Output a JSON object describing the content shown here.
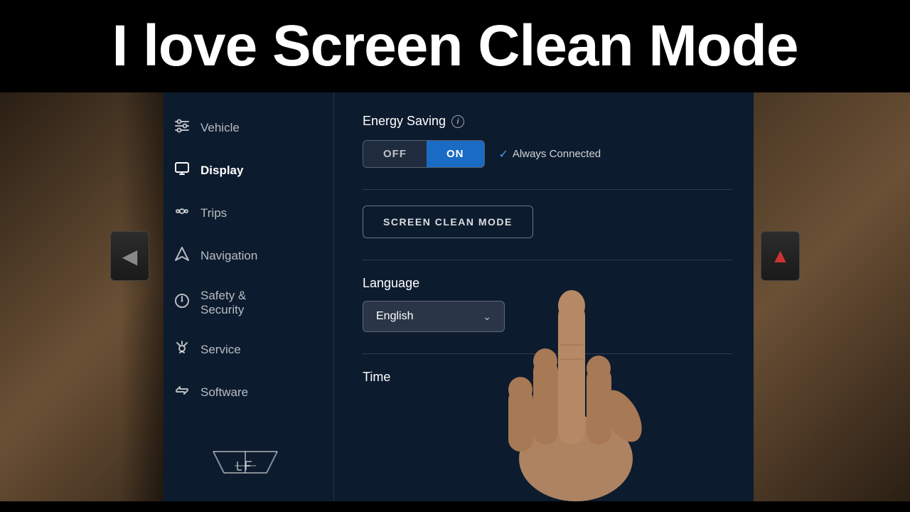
{
  "title_bar": {
    "text": "I love Screen Clean Mode"
  },
  "sidebar": {
    "items": [
      {
        "id": "vehicle",
        "label": "Vehicle",
        "icon": "sliders"
      },
      {
        "id": "display",
        "label": "Display",
        "icon": "display",
        "active": true
      },
      {
        "id": "trips",
        "label": "Trips",
        "icon": "trips"
      },
      {
        "id": "navigation",
        "label": "Navigation",
        "icon": "navigation"
      },
      {
        "id": "safety_security",
        "label": "Safety & Security",
        "icon": "safety"
      },
      {
        "id": "service",
        "label": "Service",
        "icon": "service"
      },
      {
        "id": "software",
        "label": "Software",
        "icon": "software"
      }
    ]
  },
  "main": {
    "energy_saving": {
      "title": "Energy Saving",
      "off_label": "OFF",
      "on_label": "ON",
      "on_active": true,
      "always_connected_label": "Always Connected"
    },
    "screen_clean_mode": {
      "button_label": "SCREEN CLEAN MODE"
    },
    "language": {
      "label": "Language",
      "selected": "English"
    },
    "time": {
      "label": "Time"
    }
  },
  "colors": {
    "screen_bg": "#0d1b2e",
    "toggle_active": "#1a6bc4",
    "accent": "#4a9ff5"
  }
}
